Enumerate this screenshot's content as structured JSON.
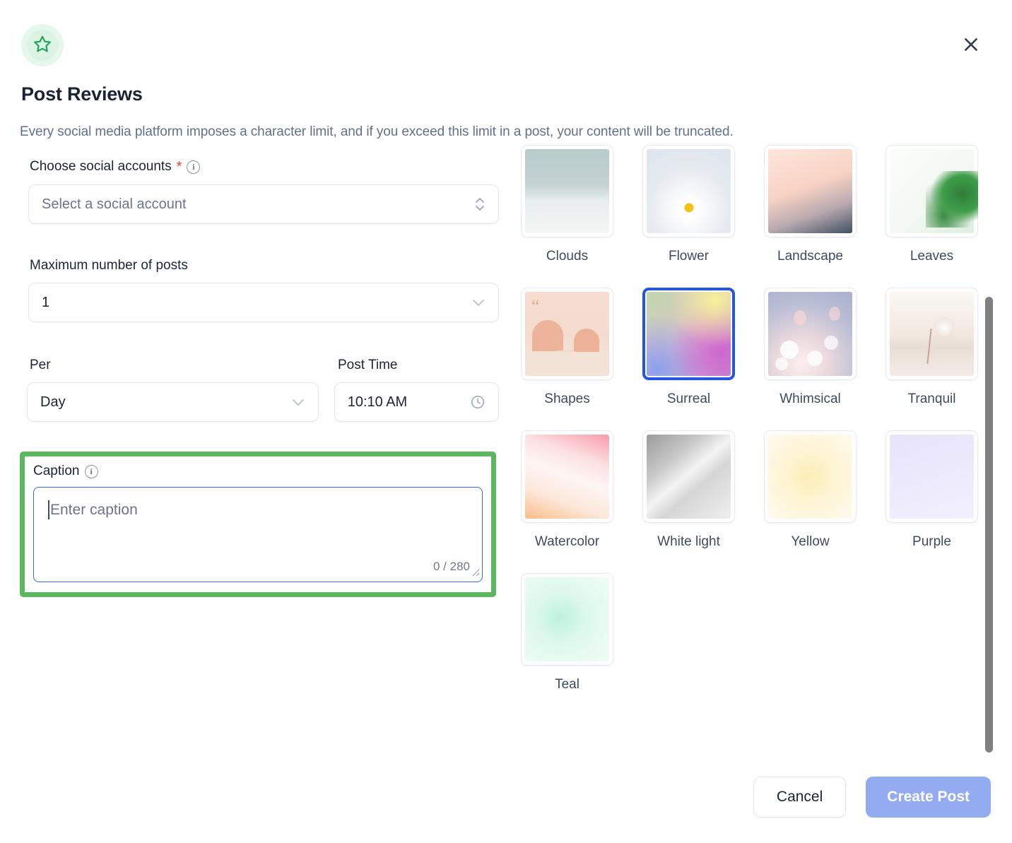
{
  "header": {
    "icon": "star-icon",
    "title": "Post Reviews",
    "subtitle": "Every social media platform imposes a character limit, and if you exceed this limit in a post, your content will be truncated.",
    "close_label": "×"
  },
  "form": {
    "social_accounts": {
      "label": "Choose social accounts",
      "required_marker": "*",
      "info": "i",
      "placeholder": "Select a social account",
      "value": ""
    },
    "max_posts": {
      "label": "Maximum number of posts",
      "value": "1"
    },
    "per": {
      "label": "Per",
      "value": "Day"
    },
    "post_time": {
      "label": "Post Time",
      "value": "10:10 AM"
    },
    "caption": {
      "label": "Caption",
      "info": "i",
      "placeholder": "Enter caption",
      "value": "",
      "counter": "0 / 280",
      "max_length": 280
    }
  },
  "image_grid": {
    "selected": "Surreal",
    "tiles": [
      {
        "label": "Clouds",
        "art": "t-clouds"
      },
      {
        "label": "Flower",
        "art": "t-flower"
      },
      {
        "label": "Landscape",
        "art": "t-landscape"
      },
      {
        "label": "Leaves",
        "art": "t-leaves"
      },
      {
        "label": "Shapes",
        "art": "t-shapes"
      },
      {
        "label": "Surreal",
        "art": "t-surreal"
      },
      {
        "label": "Whimsical",
        "art": "t-whimsical"
      },
      {
        "label": "Tranquil",
        "art": "t-tranquil"
      },
      {
        "label": "Watercolor",
        "art": "t-watercolor"
      },
      {
        "label": "White light",
        "art": "t-whitelight"
      },
      {
        "label": "Yellow",
        "art": "t-yellow"
      },
      {
        "label": "Purple",
        "art": "t-purple"
      },
      {
        "label": "Teal",
        "art": "t-teal"
      }
    ]
  },
  "footer": {
    "cancel_label": "Cancel",
    "primary_label": "Create Post"
  },
  "colors": {
    "accent_green": "#5cb85f",
    "badge_green": "#21a35b",
    "selection_blue": "#2456e6",
    "focus_blue": "#2f6fdd",
    "primary_button": "#93abf0",
    "required_red": "#e5442f",
    "title_navy": "#1b2437",
    "muted_slate": "#61708c",
    "scrollbar_gray": "#808080"
  }
}
